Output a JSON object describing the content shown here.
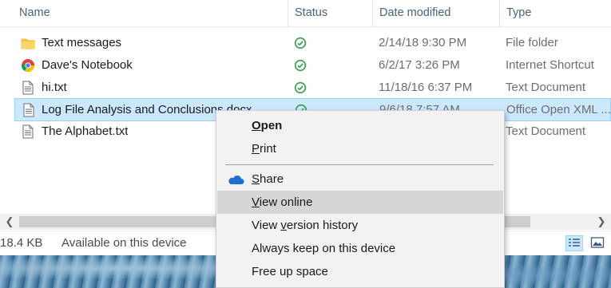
{
  "columns": {
    "name": "Name",
    "status": "Status",
    "date_modified": "Date modified",
    "type": "Type"
  },
  "files": [
    {
      "name": "Text messages",
      "icon": "folder-icon",
      "date": "2/14/18 9:30 PM",
      "type": "File folder"
    },
    {
      "name": "Dave's Notebook",
      "icon": "chrome-shortcut-icon",
      "date": "6/2/17 3:26 PM",
      "type": "Internet Shortcut"
    },
    {
      "name": "hi.txt",
      "icon": "text-file-icon",
      "date": "11/18/16 6:37 PM",
      "type": "Text Document"
    },
    {
      "name": "Log File Analysis and Conclusions.docx",
      "icon": "document-file-icon",
      "date": "9/6/18 7:57 AM",
      "type": "Office Open XML ..."
    },
    {
      "name": "The Alphabet.txt",
      "icon": "text-file-icon",
      "date": "",
      "type": "Text Document"
    }
  ],
  "status_bar": {
    "size": "18.4 KB",
    "availability": "Available on this device"
  },
  "context_menu": {
    "open_pre": "",
    "open_u": "O",
    "open_post": "pen",
    "print_pre": "",
    "print_u": "P",
    "print_post": "rint",
    "share_pre": "",
    "share_u": "S",
    "share_post": "hare",
    "view_online_pre": "",
    "view_online_u": "V",
    "view_online_post": "iew online",
    "version_pre": "View ",
    "version_u": "v",
    "version_post": "ersion history",
    "always_keep": "Always keep on this device",
    "free_up": "Free up space"
  },
  "colors": {
    "selection_bg": "#cce8ff",
    "selection_border": "#99d1ff",
    "status_green": "#2e9e44",
    "onedrive_blue": "#1e6fd0",
    "menu_highlight": "#d6d6d6"
  }
}
